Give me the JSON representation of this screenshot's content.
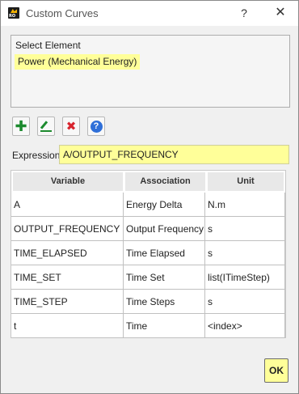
{
  "window": {
    "title": "Custom Curves",
    "icon_text": "RO",
    "help_glyph": "?",
    "close_glyph": "✕"
  },
  "select_element": {
    "label": "Select Element",
    "selected_item": "Power (Mechanical Energy)"
  },
  "toolbar": {
    "add_icon": "plus-icon",
    "edit_icon": "pencil-icon",
    "delete_icon": "red-x-icon",
    "help_icon": "question-icon",
    "add_glyph": "✚",
    "delete_glyph": "✖",
    "help_glyph": "?"
  },
  "expression": {
    "label": "Expression",
    "value": "A/OUTPUT_FREQUENCY"
  },
  "table": {
    "headers": [
      "Variable",
      "Association",
      "Unit"
    ],
    "rows": [
      [
        "A",
        "Energy Delta",
        "N.m"
      ],
      [
        "OUTPUT_FREQUENCY",
        "Output Frequency",
        "s"
      ],
      [
        "TIME_ELAPSED",
        "Time Elapsed",
        "s"
      ],
      [
        "TIME_SET",
        "Time Set",
        "list(ITimeStep)"
      ],
      [
        "TIME_STEP",
        "Time Steps",
        "s"
      ],
      [
        "t",
        "Time",
        "<index>"
      ]
    ]
  },
  "ok_button": {
    "label": "OK"
  },
  "colors": {
    "highlight": "#ffff99",
    "add_green": "#1c8a2e",
    "delete_red": "#d8252f",
    "info_blue": "#2f6fd8"
  }
}
